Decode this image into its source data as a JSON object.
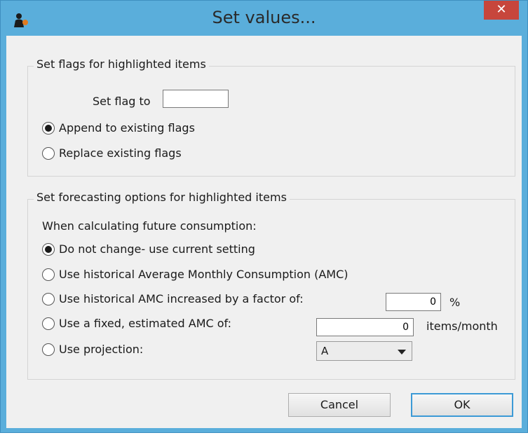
{
  "window": {
    "title": "Set values...",
    "close_label": "✕",
    "icon": "app-person-icon"
  },
  "flags_group": {
    "title": "Set flags for highlighted items",
    "set_flag_label": "Set flag to",
    "set_flag_value": "",
    "options": [
      {
        "label": "Append to existing flags",
        "checked": true
      },
      {
        "label": "Replace existing flags",
        "checked": false
      }
    ]
  },
  "forecast_group": {
    "title": "Set forecasting options for highlighted items",
    "intro": "When calculating future consumption:",
    "options": [
      {
        "label": "Do not change- use current setting",
        "checked": true
      },
      {
        "label": "Use historical Average Monthly Consumption (AMC)",
        "checked": false
      },
      {
        "label": "Use historical AMC increased by a factor of:",
        "checked": false
      },
      {
        "label": "Use a fixed, estimated AMC of:",
        "checked": false
      },
      {
        "label": "Use projection:",
        "checked": false
      }
    ],
    "factor_value": "0",
    "factor_unit": "%",
    "fixed_amc_value": "0",
    "fixed_amc_unit": "items/month",
    "projection_value": "A"
  },
  "buttons": {
    "cancel": "Cancel",
    "ok": "OK"
  }
}
